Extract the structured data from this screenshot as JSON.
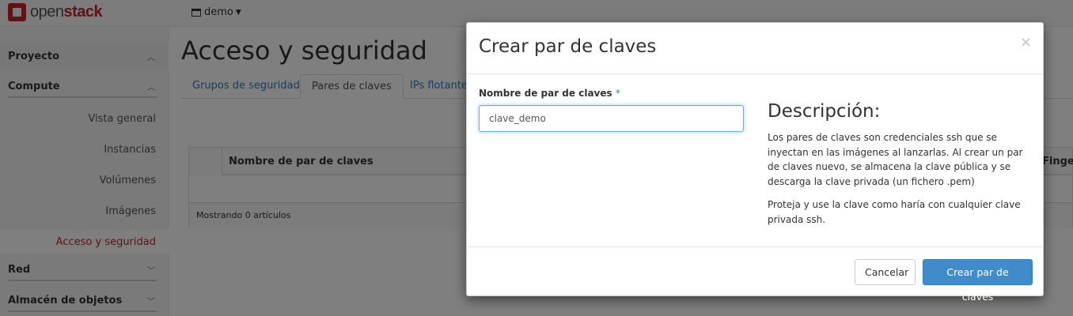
{
  "topbar": {
    "logo_prefix": "open",
    "logo_suffix": "stack",
    "project_name": "demo"
  },
  "sidebar": {
    "dashboard_label": "Proyecto",
    "compute_label": "Compute",
    "items": [
      {
        "label": "Vista general"
      },
      {
        "label": "Instancias"
      },
      {
        "label": "Volúmenes"
      },
      {
        "label": "Imágenes"
      },
      {
        "label": "Acceso y seguridad"
      }
    ],
    "network_label": "Red",
    "object_store_label": "Almacén de objetos"
  },
  "main": {
    "title": "Acceso y seguridad",
    "tabs": [
      {
        "label": "Grupos de seguridad"
      },
      {
        "label": "Pares de claves"
      },
      {
        "label": "IPs flotantes"
      }
    ],
    "table": {
      "col_name": "Nombre de par de claves",
      "col_fingerprint": "Fingerp",
      "footer": "Mostrando 0 artículos"
    }
  },
  "modal": {
    "title": "Crear par de claves",
    "close_glyph": "×",
    "field_label": "Nombre de par de claves",
    "required_mark": "*",
    "field_value": "clave_demo",
    "desc_title": "Descripción:",
    "desc_p1": "Los pares de claves son credenciales ssh que se inyectan en las imágenes al lanzarlas. Al crear un par de claves nuevo, se almacena la clave pública y se descarga la clave privada (un fichero .pem)",
    "desc_p2": "Proteja y use la clave como haría con cualquier clave privada ssh.",
    "cancel_label": "Cancelar",
    "submit_label": "Crear par de claves"
  },
  "colors": {
    "brand_red": "#c1272d",
    "primary_blue": "#428bca",
    "link_blue": "#337ab7"
  }
}
